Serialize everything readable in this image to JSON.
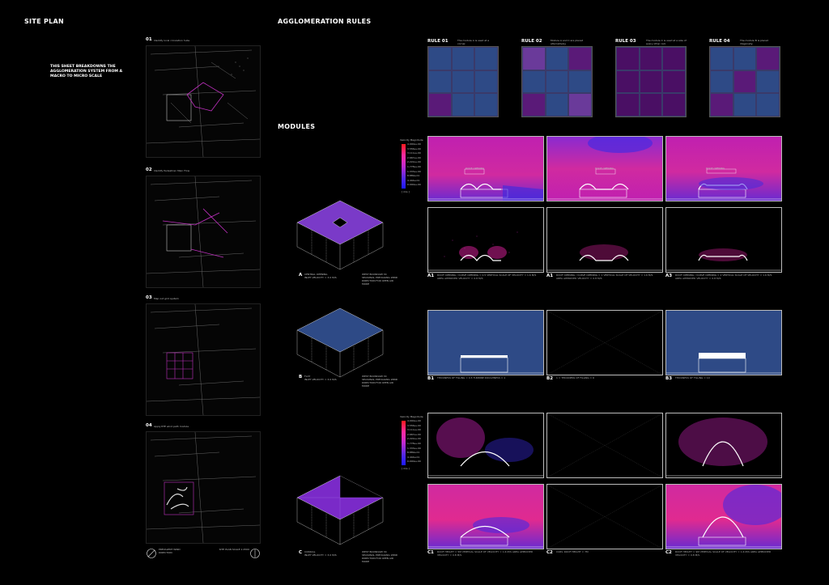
{
  "site_plan": {
    "title": "SITE PLAN",
    "intro": "THIS SHEET BREAKDOWNS THE AGGLOMERATION SYSTEM FROM A MACRO TO MICRO SCALE",
    "maps": [
      {
        "num": "01",
        "caption": "Identify local circulation hubs"
      },
      {
        "num": "02",
        "caption": "Identify Pedestrian Main Flow"
      },
      {
        "num": "03",
        "caption": "Map out grid system"
      },
      {
        "num": "04",
        "caption": "Apply RTE wind path module"
      }
    ],
    "legend_left": "PREVALENT WIND DIRECTION",
    "legend_right": "SITE PLAN SCALE 1:2500"
  },
  "agglomeration": {
    "title": "AGGLOMERATION RULES",
    "rules": [
      {
        "name": "RULE 01",
        "note": "The module A is used at a corner.",
        "cells": [
          "#2e4a86",
          "#2e4a86",
          "#2e4a86",
          "#2e4a86",
          "#2e4a86",
          "#2e4a86",
          "#5a1a78",
          "#2e4a86",
          "#2e4a86"
        ]
      },
      {
        "name": "RULE 02",
        "note": "Module A and C are placed alternatively.",
        "cells": [
          "#6a3a9a",
          "#2e4a86",
          "#5a1a78",
          "#2e4a86",
          "#2e4a86",
          "#2e4a86",
          "#5a1a78",
          "#2e4a86",
          "#6a3a9a"
        ]
      },
      {
        "name": "RULE 03",
        "note": "The module C is used at a size of every other cell.",
        "cells": [
          "#4a0f64",
          "#4a0f64",
          "#4a0f64",
          "#4a0f64",
          "#4a0f64",
          "#4a0f64",
          "#4a0f64",
          "#4a0f64",
          "#4a0f64"
        ]
      },
      {
        "name": "RULE 04",
        "note": "The module B is placed diagonally.",
        "cells": [
          "#2e4a86",
          "#2e4a86",
          "#5a1a78",
          "#2e4a86",
          "#5a1a78",
          "#2e4a86",
          "#5a1a78",
          "#2e4a86",
          "#2e4a86"
        ]
      }
    ]
  },
  "modules": {
    "title": "MODULES",
    "items": [
      {
        "letter": "A",
        "name": "CENTRAL OPENING",
        "sub": "INLET VELOCITY = 3.0 M/S",
        "note": "WEST BOUNDARY IN SEASONAL PREVAILING WIND DIRECTION FOR OPEN AIR MODE"
      },
      {
        "letter": "B",
        "name": "FLAT",
        "sub": "INLET VELOCITY = 3.0 M/S",
        "note": "WEST BOUNDARY IN SEASONAL PREVAILING WIND DIRECTION FOR OPEN AIR MODE"
      },
      {
        "letter": "C",
        "name": "CONICAL",
        "sub": "INLET VELOCITY = 3.0 M/S",
        "note": "WEST BOUNDARY IN SEASONAL PREVAILING WIND DIRECTION FOR OPEN AIR MODE"
      }
    ]
  },
  "legend": {
    "title": "Velocity Magnitude",
    "ticks": [
      "4.000e+00",
      "3.556e+00",
      "3.111e+00",
      "2.667e+00",
      "2.222e+00",
      "1.778e+00",
      "1.333e+00",
      "8.889e-01",
      "4.444e-01",
      "0.000e+00"
    ],
    "unit": "[ m/s ]"
  },
  "sim_panels": {
    "a_top_labels": [
      "ROOF OPENING",
      "ROOF OPENING",
      "ROOF OPENING"
    ],
    "captions": [
      {
        "code": "A1",
        "text": "ROOF OPENING / CURVE OPENING = 0.5  VERTICAL SCALE OF VELOCITY = 1.6 M/S  AREA APPROVED VELOCITY = 0.8 M/S"
      },
      {
        "code": "A1",
        "text": "ROOF OPENING / CURVE OPENING = 1  VERTICAL SCALE OF VELOCITY = 1.6 M/S  AREA APPROVED VELOCITY = 0.8 M/S"
      },
      {
        "code": "A3",
        "text": "ROOF OPENING / CURVE OPENING = 2  VERTICAL SCALE OF VELOCITY = 1.6 M/S  AREA APPROVED VELOCITY = 0.8 M/S"
      },
      {
        "code": "B1",
        "text": "THICKNESS OF FILLING = 0.5  TURBINE ROUGHNESS = 1"
      },
      {
        "code": "B2",
        "text": "1 = THICKNESS OF FILLING = 6"
      },
      {
        "code": "B3",
        "text": "THICKNESS OF FILLING = 10"
      },
      {
        "code": "C1",
        "text": "ROOF HEIGHT = 5M  VERTICAL SCALE OF VELOCITY = 1.6 M/S  AREA APPROVED VELOCITY = 0.8 M/S"
      },
      {
        "code": "C2",
        "text": "CURV. ROOF HEIGHT = 7M"
      },
      {
        "code": "C2",
        "text": "ROOF HEIGHT = 9M  VERTICAL SCALE OF VELOCITY = 1.6 M/S  AREA APPROVED VELOCITY = 0.8 M/S"
      }
    ]
  },
  "colors": {
    "blue": "#2e4a86",
    "purple": "#5a1a78",
    "magenta": "#e0208a",
    "pink": "#c030c0",
    "violet": "#7a2ac8"
  }
}
